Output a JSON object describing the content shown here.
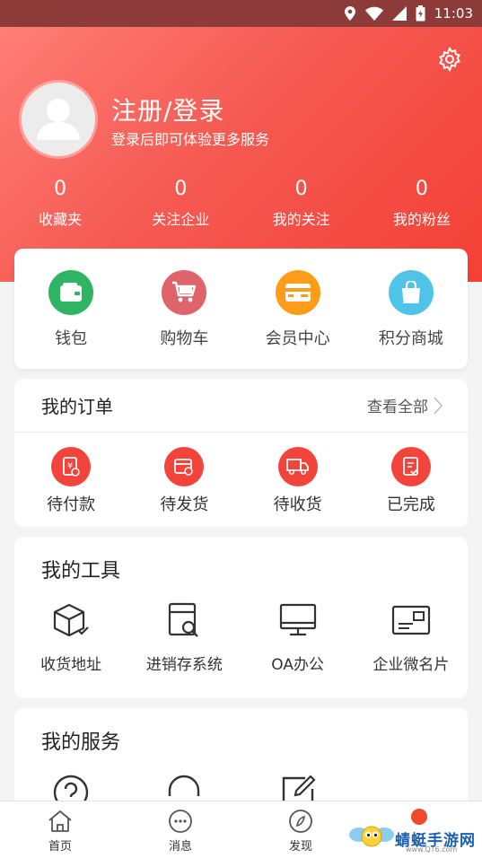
{
  "status_bar": {
    "time": "11:03"
  },
  "header": {
    "title": "注册/登录",
    "subtitle": "登录后即可体验更多服务",
    "stats": [
      {
        "value": "0",
        "label": "收藏夹"
      },
      {
        "value": "0",
        "label": "关注企业"
      },
      {
        "value": "0",
        "label": "我的关注"
      },
      {
        "value": "0",
        "label": "我的粉丝"
      }
    ]
  },
  "quick_actions": [
    {
      "label": "钱包",
      "icon": "wallet-icon",
      "color": "#2eb462"
    },
    {
      "label": "购物车",
      "icon": "cart-icon",
      "color": "#e0636b"
    },
    {
      "label": "会员中心",
      "icon": "vip-card-icon",
      "color": "#ff9d1a"
    },
    {
      "label": "积分商城",
      "icon": "shopping-bag-icon",
      "color": "#4fc3e8"
    }
  ],
  "orders": {
    "title": "我的订单",
    "view_all": "查看全部",
    "items": [
      {
        "label": "待付款",
        "icon": "payment-icon"
      },
      {
        "label": "待发货",
        "icon": "package-icon"
      },
      {
        "label": "待收货",
        "icon": "truck-icon"
      },
      {
        "label": "已完成",
        "icon": "completed-icon"
      }
    ]
  },
  "tools": {
    "title": "我的工具",
    "items": [
      {
        "label": "收货地址",
        "icon": "box-icon"
      },
      {
        "label": "进销存系统",
        "icon": "inventory-icon"
      },
      {
        "label": "OA办公",
        "icon": "monitor-icon"
      },
      {
        "label": "企业微名片",
        "icon": "business-card-icon"
      }
    ]
  },
  "services": {
    "title": "我的服务"
  },
  "tabbar": [
    {
      "label": "首页",
      "icon": "home-icon"
    },
    {
      "label": "消息",
      "icon": "message-icon"
    },
    {
      "label": "发现",
      "icon": "compass-icon"
    }
  ],
  "watermark": {
    "text": "蜻蜓手游网",
    "url": "www.QT6.com"
  },
  "colors": {
    "primary": "#f44035",
    "order_icon_bg": "#f2443a"
  }
}
